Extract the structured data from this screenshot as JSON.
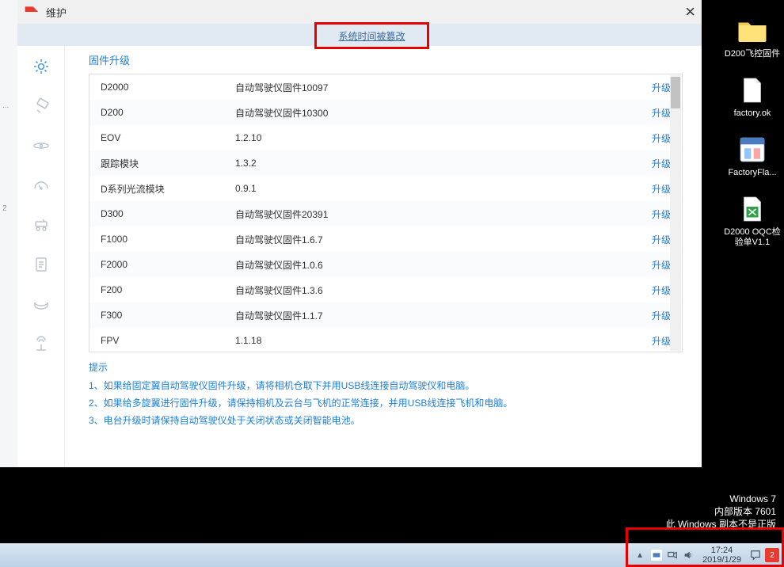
{
  "window": {
    "title": "维护",
    "close": "×",
    "time_warning": "系统时间被篡改"
  },
  "section_title": "固件升级",
  "firmware": [
    {
      "name": "D2000",
      "version": "自动驾驶仪固件10097",
      "action": "升级"
    },
    {
      "name": "D200",
      "version": "自动驾驶仪固件10300",
      "action": "升级"
    },
    {
      "name": "EOV",
      "version": "1.2.10",
      "action": "升级"
    },
    {
      "name": "跟踪模块",
      "version": "1.3.2",
      "action": "升级"
    },
    {
      "name": "D系列光流模块",
      "version": "0.9.1",
      "action": "升级"
    },
    {
      "name": "D300",
      "version": "自动驾驶仪固件20391",
      "action": "升级"
    },
    {
      "name": "F1000",
      "version": "自动驾驶仪固件1.6.7",
      "action": "升级"
    },
    {
      "name": "F2000",
      "version": "自动驾驶仪固件1.0.6",
      "action": "升级"
    },
    {
      "name": "F200",
      "version": "自动驾驶仪固件1.3.6",
      "action": "升级"
    },
    {
      "name": "F300",
      "version": "自动驾驶仪固件1.1.7",
      "action": "升级"
    },
    {
      "name": "FPV",
      "version": "1.1.18",
      "action": "升级"
    }
  ],
  "tips": {
    "title": "提示",
    "lines": [
      "1、如果给固定翼自动驾驶仪固件升级，请将相机仓取下并用USB线连接自动驾驶仪和电脑。",
      "2、如果给多旋翼进行固件升级，请保持相机及云台与飞机的正常连接，并用USB线连接飞机和电脑。",
      "3、电台升级时请保持自动驾驶仪处于关闭状态或关闭智能电池。"
    ]
  },
  "desktop": [
    {
      "label": "D200飞控固件"
    },
    {
      "label": "factory.ok"
    },
    {
      "label": "FactoryFla..."
    },
    {
      "label": "D2000 OQC检验单V1.1"
    }
  ],
  "watermark": {
    "line1": "Windows 7",
    "line2": "内部版本 7601",
    "line3": "此 Windows 副本不是正版"
  },
  "taskbar": {
    "time": "17:24",
    "date": "2019/1/29",
    "notif_count": "2"
  },
  "left_slice": {
    "a": "...",
    "b": "2"
  }
}
